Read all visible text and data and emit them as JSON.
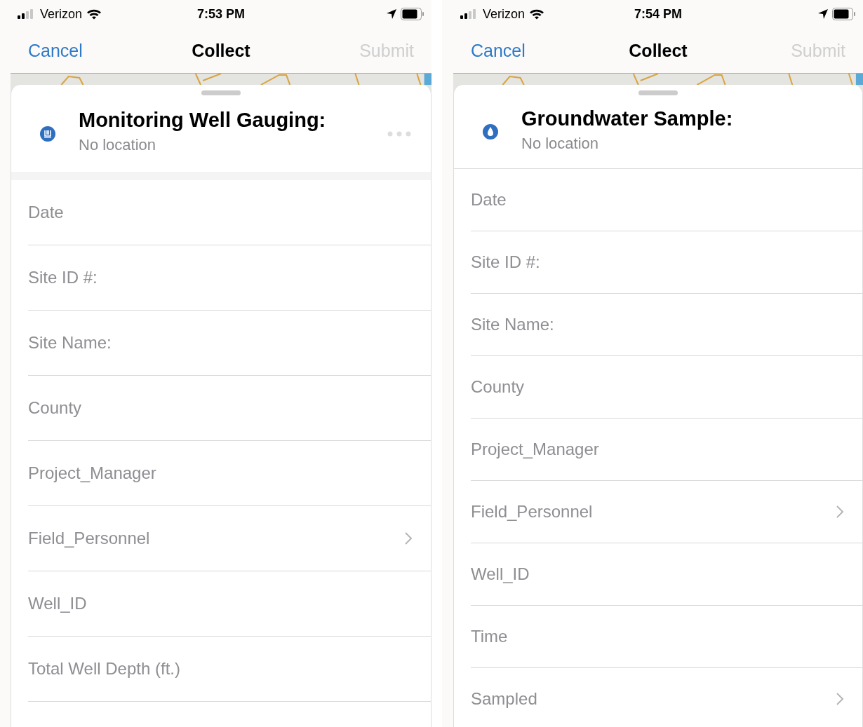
{
  "screens": [
    {
      "status_bar": {
        "carrier": "Verizon",
        "time": "7:53 PM"
      },
      "nav": {
        "cancel": "Cancel",
        "title": "Collect",
        "submit": "Submit",
        "submit_disabled": true
      },
      "form": {
        "kind": "well",
        "title": "Monitoring Well Gauging:",
        "subtitle": "No location",
        "more_menu": true,
        "fields": [
          {
            "label": "Date",
            "chevron": false
          },
          {
            "label": "Site ID #:",
            "chevron": false
          },
          {
            "label": "Site Name:",
            "chevron": false
          },
          {
            "label": "County",
            "chevron": false
          },
          {
            "label": "Project_Manager",
            "chevron": false
          },
          {
            "label": "Field_Personnel",
            "chevron": true
          },
          {
            "label": "Well_ID",
            "chevron": false
          },
          {
            "label": "Total Well Depth (ft.)",
            "chevron": false
          }
        ]
      }
    },
    {
      "status_bar": {
        "carrier": "Verizon",
        "time": "7:54 PM"
      },
      "nav": {
        "cancel": "Cancel",
        "title": "Collect",
        "submit": "Submit",
        "submit_disabled": true
      },
      "form": {
        "kind": "drop",
        "title": "Groundwater Sample:",
        "subtitle": "No location",
        "more_menu": false,
        "fields": [
          {
            "label": "Date",
            "chevron": false
          },
          {
            "label": "Site ID #:",
            "chevron": false
          },
          {
            "label": "Site Name:",
            "chevron": false
          },
          {
            "label": "County",
            "chevron": false
          },
          {
            "label": "Project_Manager",
            "chevron": false
          },
          {
            "label": "Field_Personnel",
            "chevron": true
          },
          {
            "label": "Well_ID",
            "chevron": false
          },
          {
            "label": "Time",
            "chevron": false
          },
          {
            "label": "Sampled",
            "chevron": true
          }
        ]
      }
    }
  ]
}
